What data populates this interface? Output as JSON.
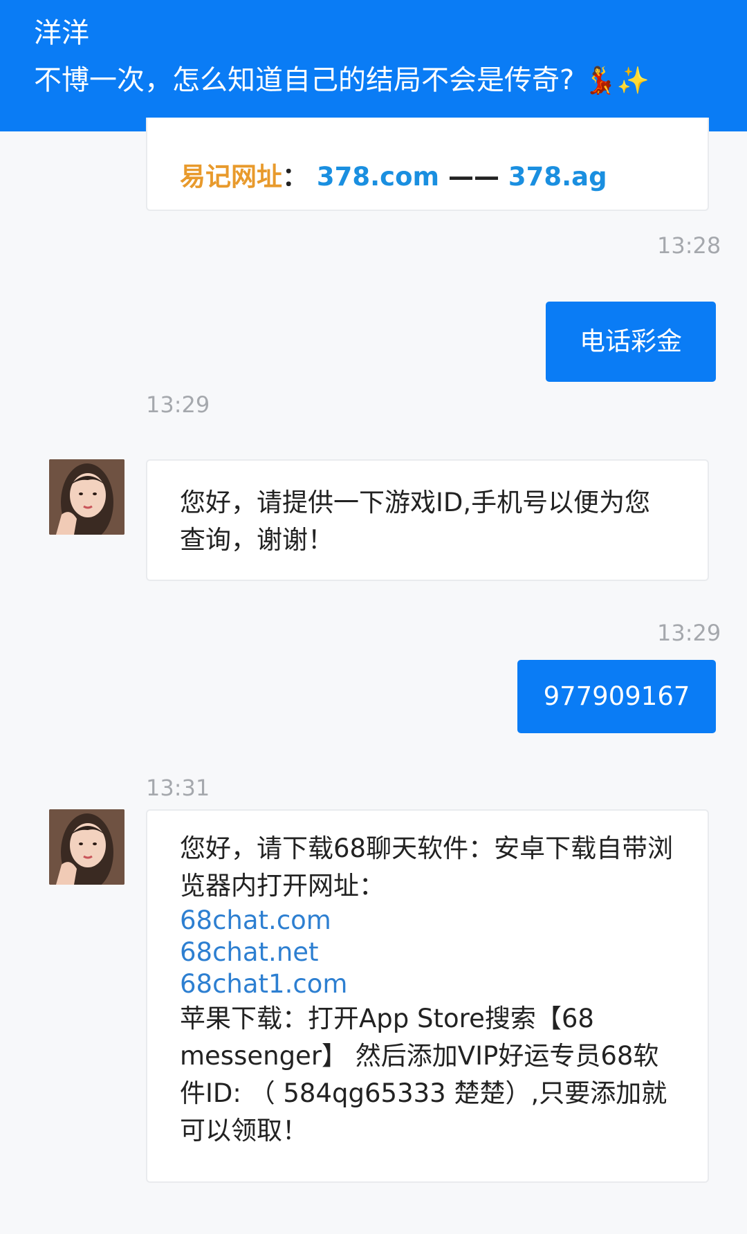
{
  "header": {
    "contact_name": "洋洋",
    "motto": "不博一次，怎么知道自己的结局不会是传奇?",
    "motto_emoji": "💃✨"
  },
  "top_message": {
    "label": "易记网址",
    "colon": "：",
    "url1": "378.com",
    "separator": "——",
    "url2": "378.ag"
  },
  "messages": [
    {
      "time": "13:28",
      "sender": "me",
      "text": "电话彩金"
    },
    {
      "time": "13:29",
      "sender": "agent",
      "text": "您好，请提供一下游戏ID,手机号以便为您查询，谢谢！"
    },
    {
      "time": "13:29",
      "sender": "me",
      "text": "977909167"
    },
    {
      "time": "13:31",
      "sender": "agent",
      "intro": "您好，请下载68聊天软件：安卓下载自带浏览器内打开网址：",
      "links": [
        "68chat.com",
        "68chat.net",
        "68chat1.com"
      ],
      "outro": "苹果下载：打开App Store搜索【68 messenger】 然后添加VIP好运专员68软件ID: （ 584qg65333 楚楚）,只要添加就可以领取！"
    }
  ],
  "colors": {
    "header_bg": "#0a7cf5",
    "outgoing_bubble": "#0a7cf5",
    "link": "#2d7fd1",
    "highlight_orange": "#e89a2c"
  },
  "icons": {
    "avatar": "agent-avatar-photo"
  }
}
